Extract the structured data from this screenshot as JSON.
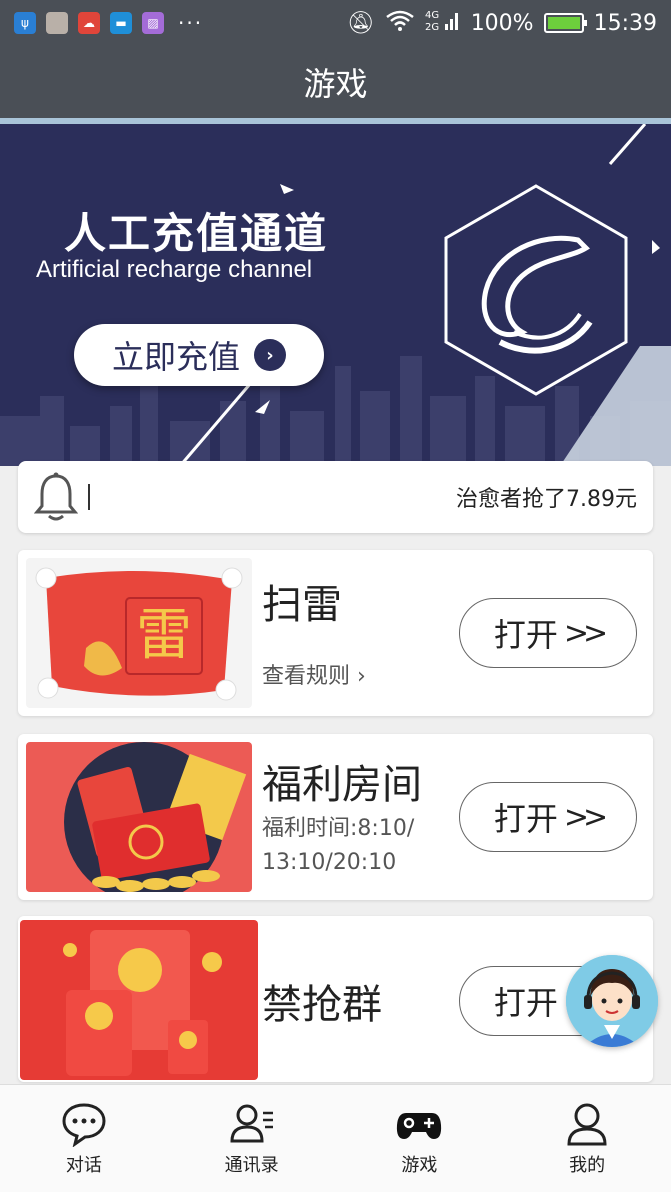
{
  "status_bar": {
    "icons": [
      "usb-icon",
      "photo-icon",
      "cloud-icon",
      "chat-icon",
      "gallery-icon"
    ],
    "more": "···",
    "network": "4G 2G",
    "battery": "100%",
    "time": "15:39"
  },
  "header": {
    "title": "游戏"
  },
  "banner": {
    "title": "人工充值通道",
    "subtitle": "Artificial recharge channel",
    "button_label": "立即充值",
    "button_arrow": "›"
  },
  "notice": {
    "text": "治愈者抢了7.89元"
  },
  "games": [
    {
      "title": "扫雷",
      "desc": "查看规则 ›",
      "button_label": "打开",
      "img_char": "雷"
    },
    {
      "title": "福利房间",
      "desc_lines": [
        "福利时间:8:10/",
        "13:10/20:10"
      ],
      "button_label": "打开"
    },
    {
      "title": "禁抢群",
      "button_label": "打开"
    }
  ],
  "bottom_nav": [
    {
      "label": "对话",
      "icon": "chat-bubble-icon"
    },
    {
      "label": "通讯录",
      "icon": "contacts-icon"
    },
    {
      "label": "游戏",
      "icon": "gamepad-icon"
    },
    {
      "label": "我的",
      "icon": "profile-icon"
    }
  ],
  "colors": {
    "header": "#4a4f56",
    "banner": "#2b2e5a",
    "red": "#e8463c"
  }
}
